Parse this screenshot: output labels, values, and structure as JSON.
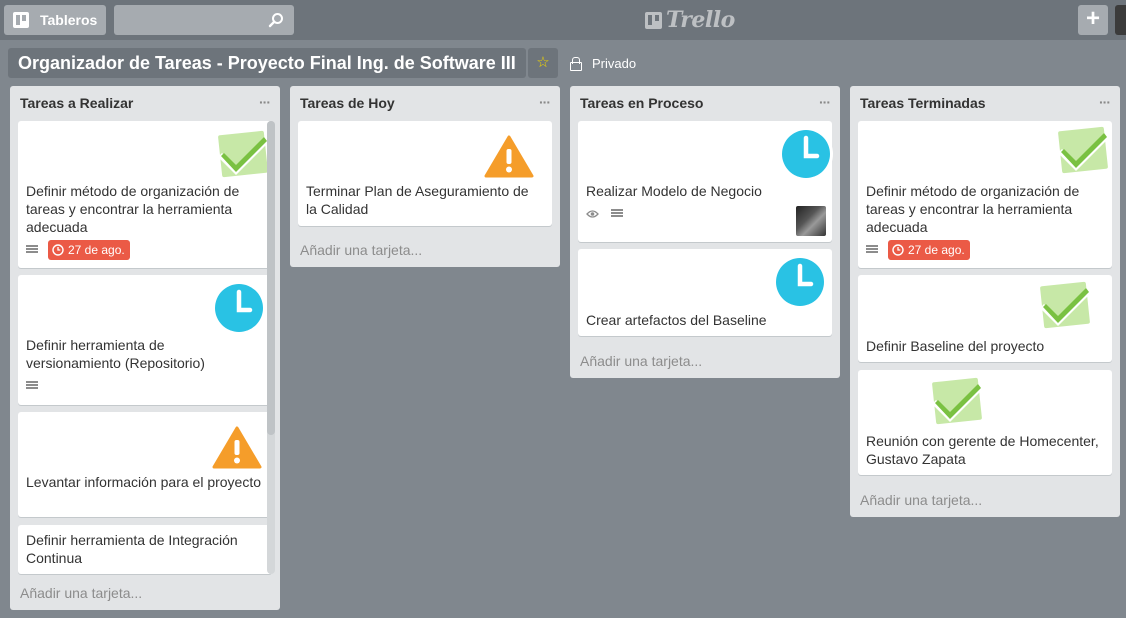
{
  "header": {
    "boards_label": "Tableros",
    "search_placeholder": "",
    "logo_text": "Trello",
    "add_label": "+"
  },
  "board": {
    "title": "Organizador de Tareas - Proyecto Final Ing. de Software III",
    "starred": true,
    "privacy": "Privado"
  },
  "colors": {
    "background": "#80878e",
    "header": "#6d747b",
    "list": "#e2e4e6",
    "due_overdue": "#eb5a46",
    "star": "#f2d600",
    "check_green": "#7ac142",
    "clock_blue": "#29c2e4",
    "warning_orange": "#f59d2a"
  },
  "lists": [
    {
      "name": "Tareas a Realizar",
      "menu": "...",
      "add_card": "Añadir una tarjeta...",
      "cards": [
        {
          "title": "Definir método de organización de tareas y encontrar la herramienta adecuada",
          "sticker": "check-icon",
          "badges": {
            "description": true,
            "due": "27 de ago."
          }
        },
        {
          "title": "Definir herramienta de versionamiento (Repositorio)",
          "sticker": "clock-icon",
          "badges": {
            "description": true
          }
        },
        {
          "title": "Levantar información para el proyecto",
          "sticker": "warning-icon"
        },
        {
          "title": "Definir herramienta de Integración Continua"
        }
      ]
    },
    {
      "name": "Tareas de Hoy",
      "menu": "...",
      "add_card": "Añadir una tarjeta...",
      "cards": [
        {
          "title": "Terminar Plan de Aseguramiento de la Calidad",
          "sticker": "warning-icon"
        }
      ]
    },
    {
      "name": "Tareas en Proceso",
      "menu": "...",
      "add_card": "Añadir una tarjeta...",
      "cards": [
        {
          "title": "Realizar Modelo de Negocio",
          "sticker": "clock-icon",
          "badges": {
            "watch": true,
            "description": true,
            "member": true
          }
        },
        {
          "title": "Crear artefactos del Baseline",
          "sticker": "clock-icon"
        }
      ]
    },
    {
      "name": "Tareas Terminadas",
      "menu": "...",
      "add_card": "Añadir una tarjeta...",
      "cards": [
        {
          "title": "Definir método de organización de tareas y encontrar la herramienta adecuada",
          "sticker": "check-icon",
          "badges": {
            "description": true,
            "due": "27 de ago."
          }
        },
        {
          "title": "Definir Baseline del proyecto",
          "sticker": "check-icon"
        },
        {
          "title": "Reunión con gerente de Homecenter, Gustavo Zapata",
          "sticker": "check-icon"
        }
      ]
    }
  ]
}
